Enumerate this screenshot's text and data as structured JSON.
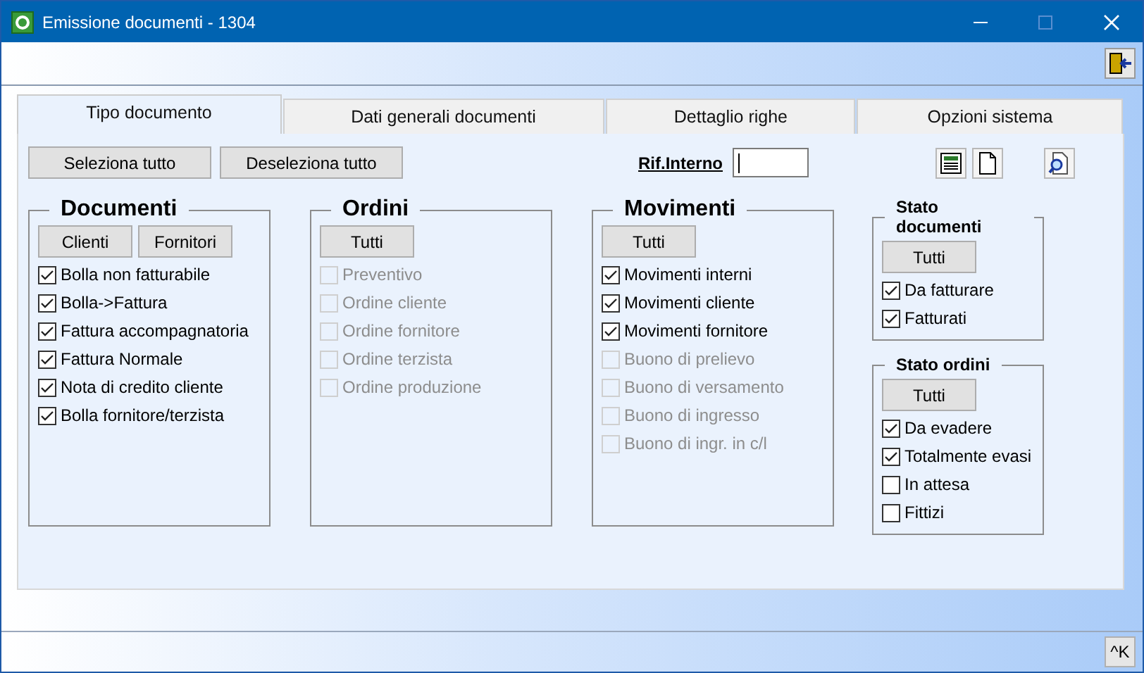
{
  "window": {
    "title": "Emissione documenti - 1304"
  },
  "tabs": [
    {
      "label": "Tipo documento",
      "selected": true
    },
    {
      "label": "Dati generali documenti",
      "selected": false
    },
    {
      "label": "Dettaglio righe",
      "selected": false
    },
    {
      "label": "Opzioni sistema",
      "selected": false
    }
  ],
  "toolbar": {
    "buttons": [
      "Seleziona tutto",
      "Deseleziona tutto"
    ],
    "ref_label": "Rif.Interno"
  },
  "columns": [
    {
      "groups": [
        {
          "title": "Documenti",
          "kind": "main",
          "buttons": [
            "Clienti",
            "Fornitori"
          ],
          "items": [
            {
              "label": "Bolla non fatturabile",
              "checked": true,
              "disabled": false
            },
            {
              "label": "Bolla->Fattura",
              "checked": true,
              "disabled": false
            },
            {
              "label": "Fattura accompagnatoria",
              "checked": true,
              "disabled": false
            },
            {
              "label": "Fattura Normale",
              "checked": true,
              "disabled": false
            },
            {
              "label": "Nota di credito cliente",
              "checked": true,
              "disabled": false
            },
            {
              "label": "Bolla fornitore/terzista",
              "checked": true,
              "disabled": false
            }
          ]
        }
      ]
    },
    {
      "groups": [
        {
          "title": "Ordini",
          "kind": "main",
          "buttons": [
            "Tutti"
          ],
          "items": [
            {
              "label": "Preventivo",
              "checked": false,
              "disabled": true
            },
            {
              "label": "Ordine cliente",
              "checked": false,
              "disabled": true
            },
            {
              "label": "Ordine fornitore",
              "checked": false,
              "disabled": true
            },
            {
              "label": "Ordine terzista",
              "checked": false,
              "disabled": true
            },
            {
              "label": "Ordine produzione",
              "checked": false,
              "disabled": true
            }
          ]
        }
      ]
    },
    {
      "groups": [
        {
          "title": "Movimenti",
          "kind": "main",
          "buttons": [
            "Tutti"
          ],
          "items": [
            {
              "label": "Movimenti interni",
              "checked": true,
              "disabled": false
            },
            {
              "label": "Movimenti cliente",
              "checked": true,
              "disabled": false
            },
            {
              "label": "Movimenti fornitore",
              "checked": true,
              "disabled": false
            },
            {
              "label": "Buono di prelievo",
              "checked": false,
              "disabled": true
            },
            {
              "label": "Buono di versamento",
              "checked": false,
              "disabled": true
            },
            {
              "label": "Buono di ingresso",
              "checked": false,
              "disabled": true
            },
            {
              "label": "Buono di ingr. in c/l",
              "checked": false,
              "disabled": true
            }
          ]
        }
      ]
    },
    {
      "groups": [
        {
          "title": "Stato documenti",
          "kind": "small",
          "buttons": [
            "Tutti"
          ],
          "items": [
            {
              "label": "Da fatturare",
              "checked": true,
              "disabled": false
            },
            {
              "label": "Fatturati",
              "checked": true,
              "disabled": false
            }
          ]
        },
        {
          "title": "Stato ordini",
          "kind": "small",
          "buttons": [
            "Tutti"
          ],
          "items": [
            {
              "label": "Da evadere",
              "checked": true,
              "disabled": false
            },
            {
              "label": "Totalmente evasi",
              "checked": true,
              "disabled": false
            },
            {
              "label": "In attesa",
              "checked": false,
              "disabled": false
            },
            {
              "label": "Fittizi",
              "checked": false,
              "disabled": false
            }
          ]
        }
      ]
    }
  ],
  "shortcut_button": "^K"
}
